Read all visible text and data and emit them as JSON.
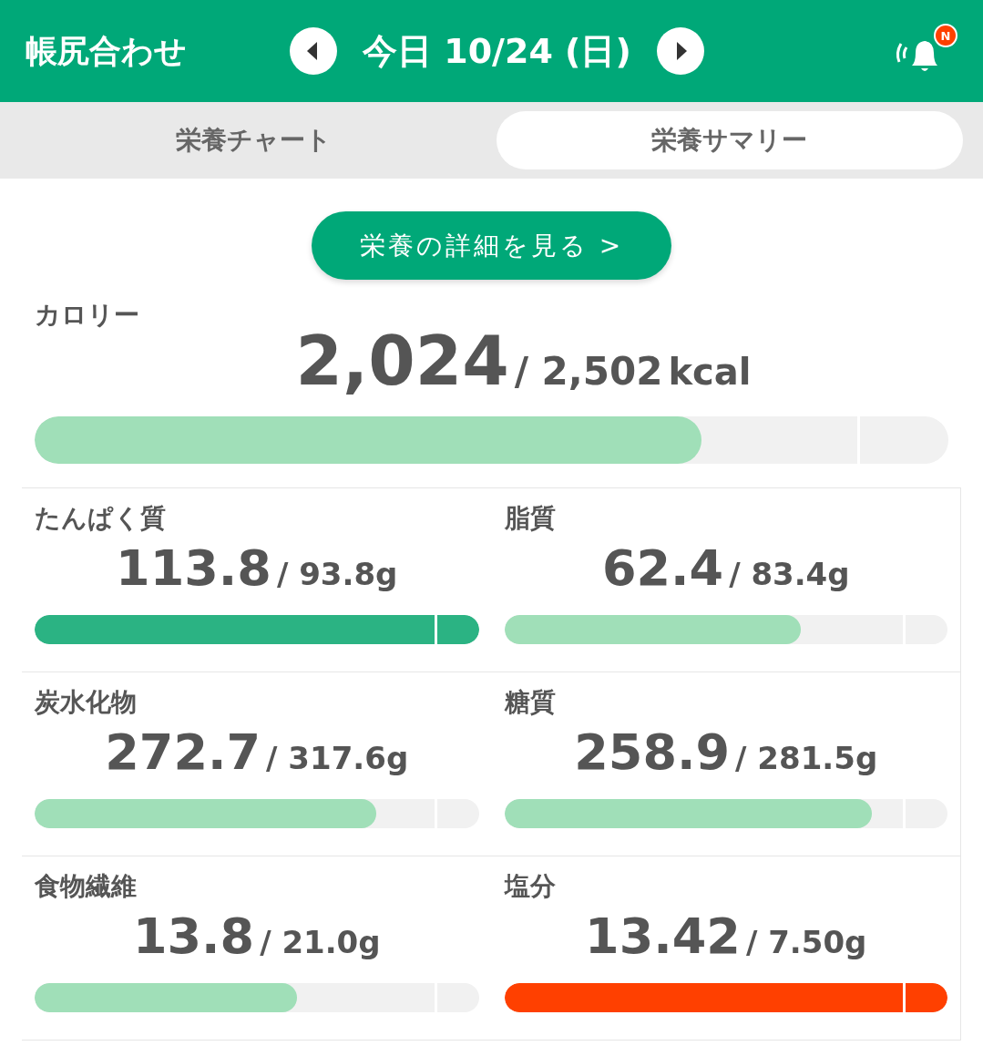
{
  "header": {
    "title": "帳尻合わせ",
    "date": "今日 10/24 (日)",
    "notification_badge": "N"
  },
  "tabs": [
    {
      "label": "栄養チャート",
      "selected": false
    },
    {
      "label": "栄養サマリー",
      "selected": true
    }
  ],
  "detail_button": "栄養の詳細を見る >",
  "calorie": {
    "label": "カロリー",
    "value": "2,024",
    "target": "/ 2,502",
    "unit": "kcal",
    "level": 0.73,
    "color": "#a0dfb8"
  },
  "nutrients": [
    {
      "label": "たんぱく質",
      "value": "113.8",
      "target": "/ 93.8g",
      "level": 1,
      "color": "#2bb383"
    },
    {
      "label": "脂質",
      "value": "62.4",
      "target": "/ 83.4g",
      "level": 0.67,
      "color": "#a0dfb8"
    },
    {
      "label": "炭水化物",
      "value": "272.7",
      "target": "/ 317.6g",
      "level": 0.77,
      "color": "#a0dfb8"
    },
    {
      "label": "糖質",
      "value": "258.9",
      "target": "/ 281.5g",
      "level": 0.83,
      "color": "#a0dfb8"
    },
    {
      "label": "食物繊維",
      "value": "13.8",
      "target": "/ 21.0g",
      "level": 0.59,
      "color": "#a0dfb8"
    },
    {
      "label": "塩分",
      "value": "13.42",
      "target": "/ 7.50g",
      "level": 1,
      "color": "#ff4000"
    }
  ]
}
